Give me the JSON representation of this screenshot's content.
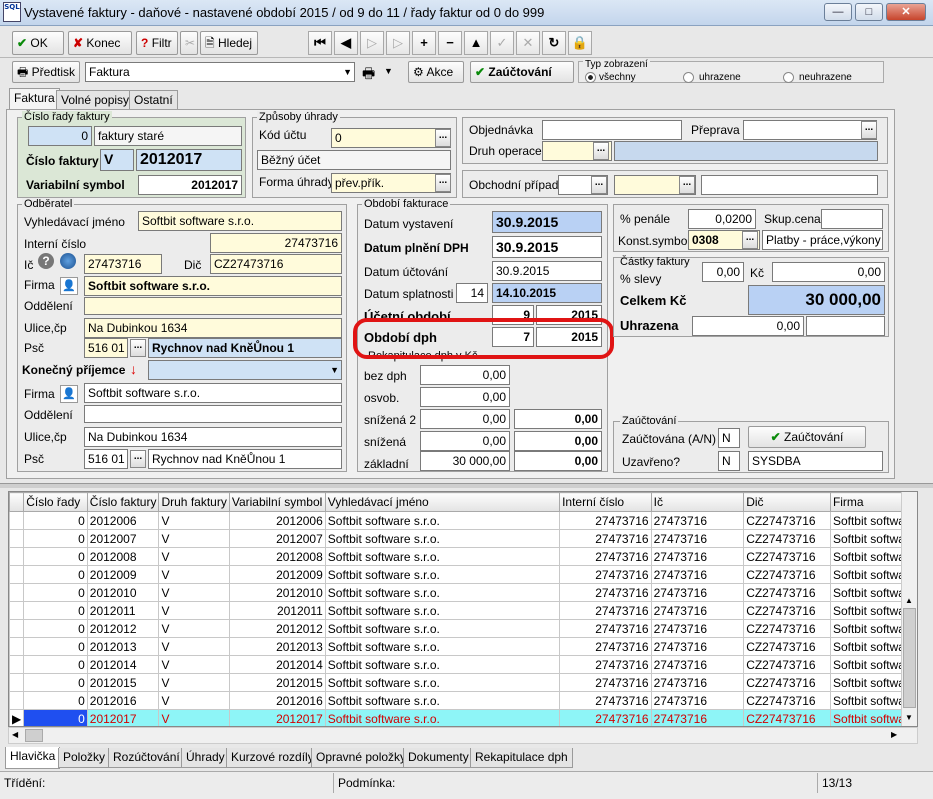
{
  "window": {
    "title": "Vystavené faktury - daňové - nastavené období 2015 / od 9 do 11 / řady faktur od 0 do 999",
    "logo": "SQL"
  },
  "toolbar": {
    "ok": "OK",
    "konec": "Konec",
    "filtr": "Filtr",
    "hledej": "Hledej"
  },
  "toolbar2": {
    "predtisk": "Předtisk",
    "report": "Faktura",
    "akce": "Akce",
    "zauctovani": "Zaúčtování",
    "typ_zobrazeni": "Typ zobrazení",
    "opt_vsechny": "všechny",
    "opt_uhrazene": "uhrazene",
    "opt_neuhrazene": "neuhrazene"
  },
  "tabs": [
    "Faktura",
    "Volné popisy",
    "Ostatní"
  ],
  "cislo_rady": {
    "title": "Číslo řady faktury",
    "rada": "0",
    "rada_label": "faktury staré",
    "cislo_label": "Číslo faktury",
    "typ": "V",
    "cislo": "2012017",
    "var_label": "Variabilní symbol",
    "var": "2012017"
  },
  "zpusoby": {
    "title": "Způsoby úhrady",
    "kod_label": "Kód účtu",
    "kod": "0",
    "ucet": "Běžný účet",
    "forma_label": "Forma úhrady",
    "forma": "přev.přík."
  },
  "objednavka": {
    "obj_label": "Objednávka",
    "obj": "",
    "preprava_label": "Přeprava",
    "preprava": "",
    "druh_label": "Druh operace",
    "pripad_label": "Obchodní případ"
  },
  "odberatel": {
    "title": "Odběratel",
    "vyhl_label": "Vyhledávací jméno",
    "vyhl": "Softbit software s.r.o.",
    "int_label": "Interní číslo",
    "int": "27473716",
    "ic_label": "Ič",
    "ic": "27473716",
    "dic_label": "Dič",
    "dic": "CZ27473716",
    "firma_label": "Firma",
    "firma": "Softbit software s.r.o.",
    "oddeleni_label": "Oddělení",
    "ulice_label": "Ulice,čp",
    "ulice": "Na Dubinkou 1634",
    "psc_label": "Psč",
    "psc": "516 01",
    "mesto": "Rychnov nad KněŮnou 1"
  },
  "prijemce": {
    "title": "Konečný příjemce",
    "firma_label": "Firma",
    "firma": "Softbit software s.r.o.",
    "oddeleni_label": "Oddělení",
    "ulice_label": "Ulice,čp",
    "ulice": "Na Dubinkou 1634",
    "psc_label": "Psč",
    "psc": "516 01",
    "mesto": "Rychnov nad KněŮnou 1"
  },
  "obdobi": {
    "title": "Období fakturace",
    "vyst_label": "Datum vystavení",
    "vyst": "30.9.2015",
    "dph_label": "Datum plnění DPH",
    "dph": "30.9.2015",
    "ucet_label": "Datum účtování",
    "ucet": "30.9.2015",
    "splat_label": "Datum splatnosti",
    "splat_days": "14",
    "splat": "14.10.2015",
    "uo_label": "Účetní období",
    "uo_m": "9",
    "uo_y": "2015",
    "od_label": "Období dph",
    "od_m": "7",
    "od_y": "2015"
  },
  "rekap": {
    "title": "Rekapitulace dph v Kč",
    "bez_label": "bez dph",
    "bez": "0,00",
    "osv_label": "osvob.",
    "osv": "0,00",
    "sn2_label": "snížená 2",
    "sn2": "0,00",
    "sn2_dph": "0,00",
    "sn_label": "snížená",
    "sn": "0,00",
    "sn_dph": "0,00",
    "zak_label": "základní",
    "zak": "30 000,00",
    "zak_dph": "0,00"
  },
  "penale": {
    "pen_label": "% penále",
    "pen": "0,0200",
    "skup_label": "Skup.cena",
    "skup": "",
    "konst_label": "Konst.symbol",
    "konst": "0308",
    "konst_text": "Platby - práce,výkony a"
  },
  "castky": {
    "title": "Částky faktury",
    "sleva_label": "% slevy",
    "sleva": "0,00",
    "kc_label": "Kč",
    "kc": "0,00",
    "celkem_label": "Celkem Kč",
    "celkem": "30 000,00",
    "uhr_label": "Uhrazena",
    "uhr": "0,00"
  },
  "zauct": {
    "title": "Zaúčtování",
    "zauct_label": "Zaúčtována (A/N)",
    "zauct": "N",
    "button": "Zaúčtování",
    "uzavr_label": "Uzavřeno?",
    "uzavr": "N",
    "user": "SYSDBA"
  },
  "grid": {
    "columns": [
      "Číslo řady",
      "Číslo faktury",
      "Druh faktury",
      "Variabilní symbol",
      "Vyhledávací jméno",
      "Interní číslo",
      "Ič",
      "Dič",
      "Firma"
    ],
    "rows": [
      [
        "0",
        "2012006",
        "V",
        "2012006",
        "Softbit software s.r.o.",
        "27473716",
        "27473716",
        "CZ27473716",
        "Softbit softwar"
      ],
      [
        "0",
        "2012007",
        "V",
        "2012007",
        "Softbit software s.r.o.",
        "27473716",
        "27473716",
        "CZ27473716",
        "Softbit softwar"
      ],
      [
        "0",
        "2012008",
        "V",
        "2012008",
        "Softbit software s.r.o.",
        "27473716",
        "27473716",
        "CZ27473716",
        "Softbit softwar"
      ],
      [
        "0",
        "2012009",
        "V",
        "2012009",
        "Softbit software s.r.o.",
        "27473716",
        "27473716",
        "CZ27473716",
        "Softbit softwar"
      ],
      [
        "0",
        "2012010",
        "V",
        "2012010",
        "Softbit software s.r.o.",
        "27473716",
        "27473716",
        "CZ27473716",
        "Softbit softwar"
      ],
      [
        "0",
        "2012011",
        "V",
        "2012011",
        "Softbit software s.r.o.",
        "27473716",
        "27473716",
        "CZ27473716",
        "Softbit softwar"
      ],
      [
        "0",
        "2012012",
        "V",
        "2012012",
        "Softbit software s.r.o.",
        "27473716",
        "27473716",
        "CZ27473716",
        "Softbit softwar"
      ],
      [
        "0",
        "2012013",
        "V",
        "2012013",
        "Softbit software s.r.o.",
        "27473716",
        "27473716",
        "CZ27473716",
        "Softbit softwar"
      ],
      [
        "0",
        "2012014",
        "V",
        "2012014",
        "Softbit software s.r.o.",
        "27473716",
        "27473716",
        "CZ27473716",
        "Softbit softwar"
      ],
      [
        "0",
        "2012015",
        "V",
        "2012015",
        "Softbit software s.r.o.",
        "27473716",
        "27473716",
        "CZ27473716",
        "Softbit softwar"
      ],
      [
        "0",
        "2012016",
        "V",
        "2012016",
        "Softbit software s.r.o.",
        "27473716",
        "27473716",
        "CZ27473716",
        "Softbit softwar"
      ],
      [
        "0",
        "2012017",
        "V",
        "2012017",
        "Softbit software s.r.o.",
        "27473716",
        "27473716",
        "CZ27473716",
        "Softbit softwar"
      ]
    ],
    "selected_index": 11
  },
  "bottom_tabs": [
    "Hlavička",
    "Položky",
    "Rozúčtování",
    "Úhrady",
    "Kurzové rozdíly",
    "Opravné položky",
    "Dokumenty",
    "Rekapitulace dph"
  ],
  "status": {
    "trideni": "Třídění:",
    "podminka": "Podmínka:",
    "count": "13/13"
  }
}
